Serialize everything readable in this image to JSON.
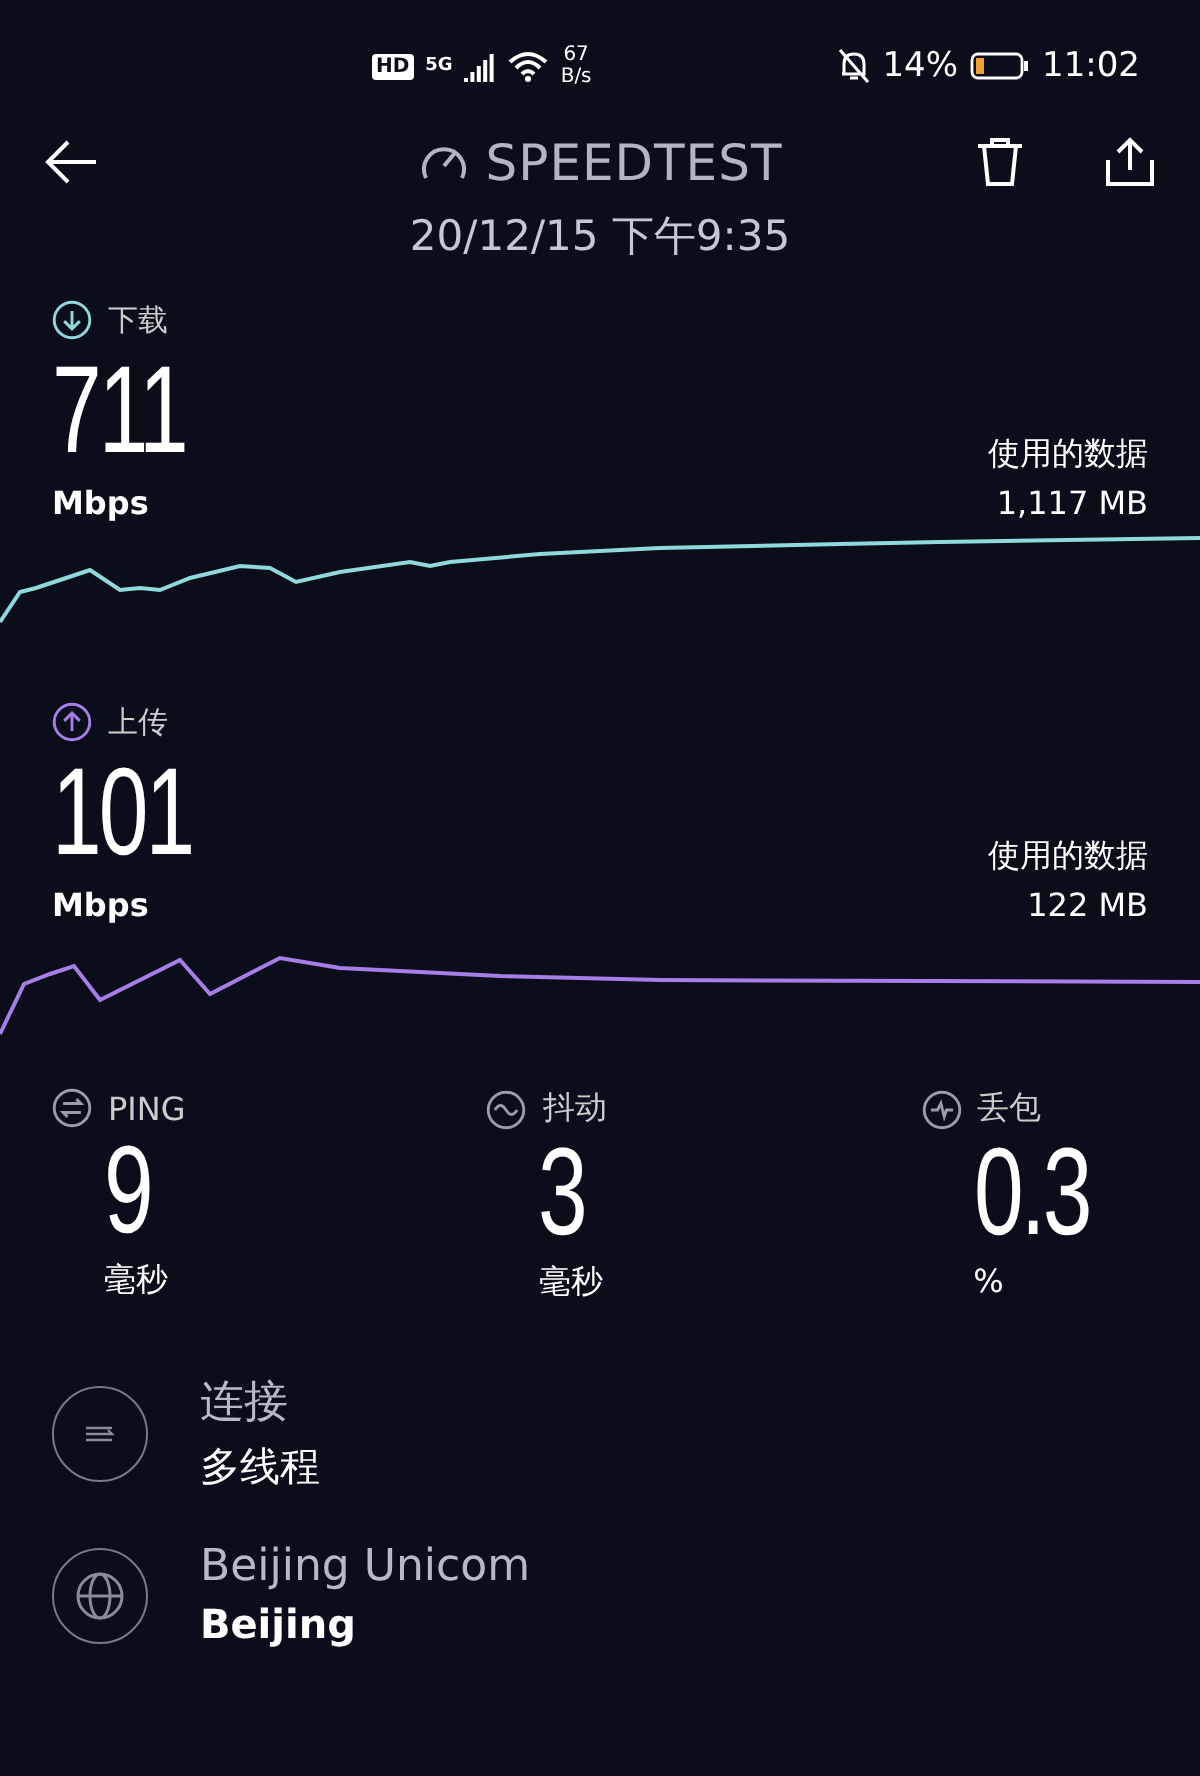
{
  "status_bar": {
    "hd": "HD",
    "network": "5G",
    "speed_value": "67",
    "speed_unit": "B/s",
    "battery_percent": "14%",
    "time": "11:02"
  },
  "header": {
    "title": "SPEEDTEST",
    "date": "20/12/15 下午9:35"
  },
  "results": [
    {
      "kind": "download",
      "label": "下载",
      "value": "711",
      "unit": "Mbps",
      "data_label": "使用的数据",
      "data_value": "1,117 MB",
      "color": "#8fd9dc"
    },
    {
      "kind": "upload",
      "label": "上传",
      "value": "101",
      "unit": "Mbps",
      "data_label": "使用的数据",
      "data_value": "122 MB",
      "color": "#a57ee8"
    }
  ],
  "metrics": [
    {
      "kind": "ping",
      "label": "PING",
      "value": "9",
      "unit": "毫秒"
    },
    {
      "kind": "jitter",
      "label": "抖动",
      "value": "3",
      "unit": "毫秒"
    },
    {
      "kind": "loss",
      "label": "丢包",
      "value": "0.3",
      "unit": "%"
    }
  ],
  "details": [
    {
      "kind": "connection",
      "title": "连接",
      "value": "多线程"
    },
    {
      "kind": "server",
      "title": "Beijing Unicom",
      "value": "Beijing"
    }
  ]
}
